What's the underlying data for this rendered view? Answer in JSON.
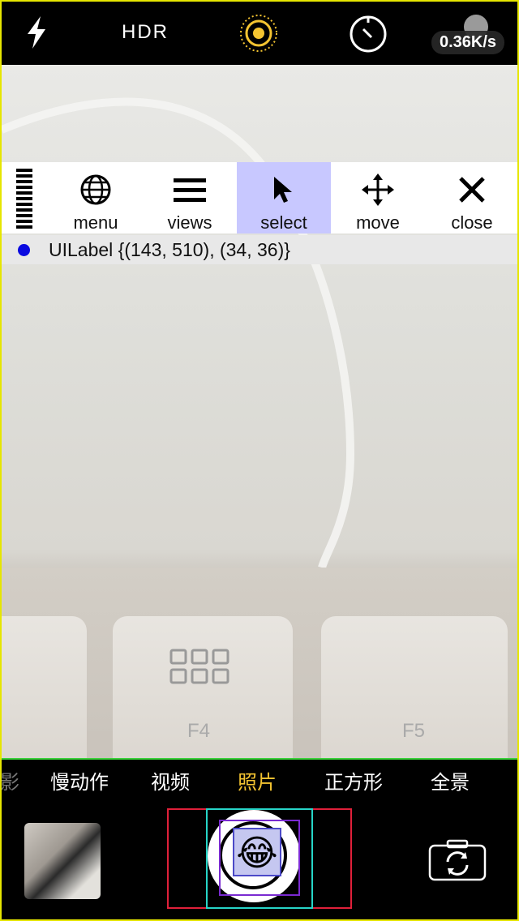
{
  "topbar": {
    "flash_icon": "flash-icon",
    "hdr_label": "HDR",
    "live_icon": "live-photo-icon",
    "timer_icon": "timer-icon",
    "network_speed": "0.36K/s"
  },
  "flex_toolbar": {
    "buttons": [
      {
        "label": "menu",
        "icon": "globe-icon"
      },
      {
        "label": "views",
        "icon": "hamburger-icon"
      },
      {
        "label": "select",
        "icon": "arrow-cursor-icon",
        "selected": true
      },
      {
        "label": "move",
        "icon": "move-arrows-icon"
      },
      {
        "label": "close",
        "icon": "close-icon"
      }
    ],
    "selection_info": "UILabel {(143, 510), (34, 36)}"
  },
  "preview": {
    "key_labels": [
      "F4",
      "F5"
    ]
  },
  "modes": {
    "items": [
      "影",
      "慢动作",
      "视频",
      "照片",
      "正方形",
      "全景"
    ],
    "active": "照片"
  },
  "shutter": {
    "emoji": "😂"
  },
  "colors": {
    "active_mode": "#f4c431",
    "selected_tool_bg": "#c8c8ff",
    "selection_dot": "#0a0ae0"
  }
}
